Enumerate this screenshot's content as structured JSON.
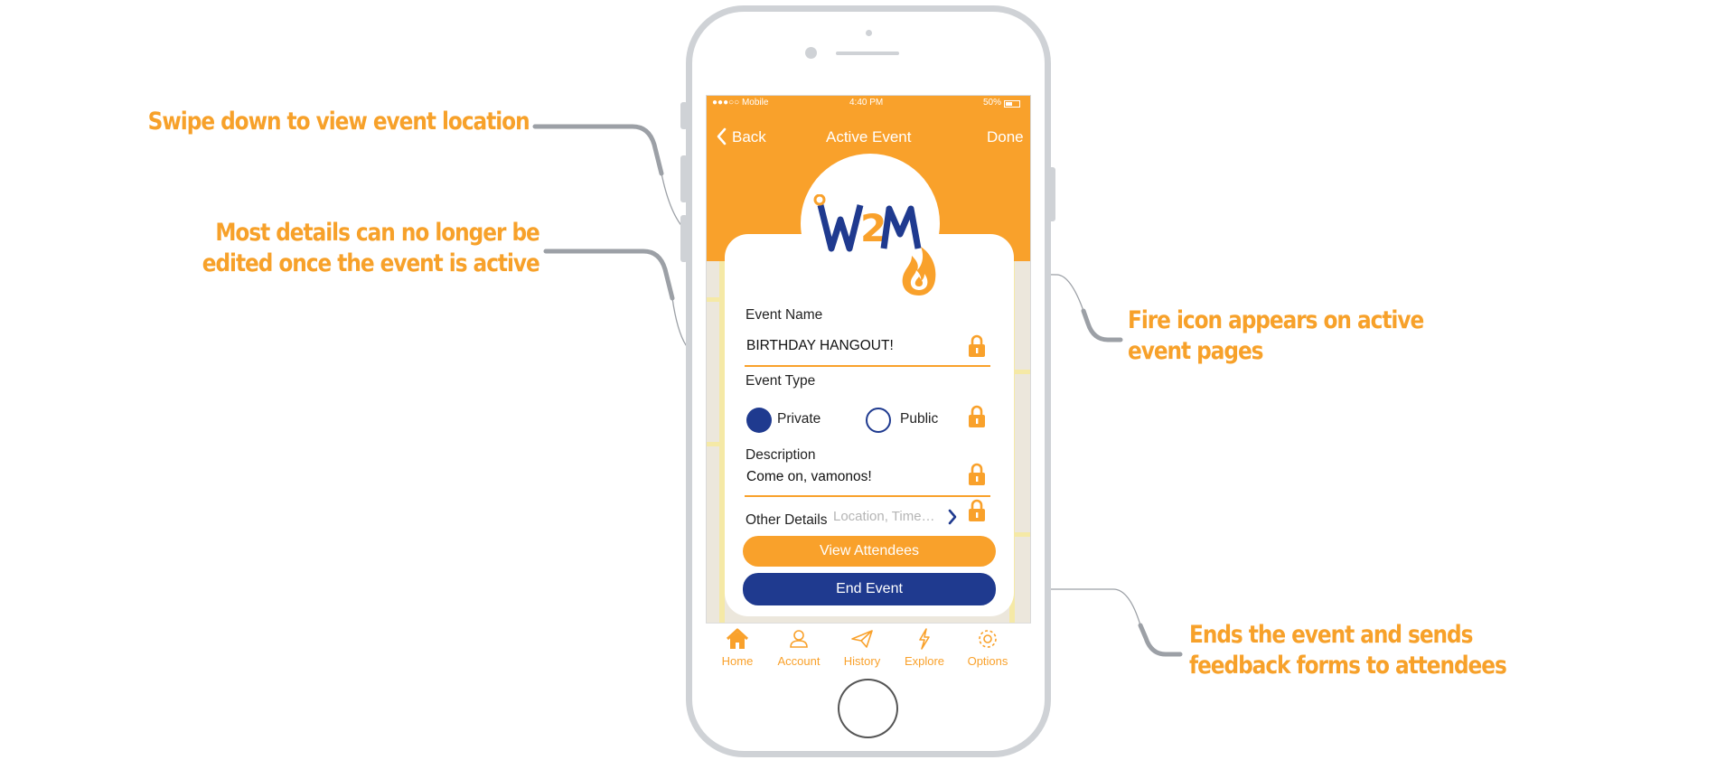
{
  "annotations": {
    "swipe": [
      "Swipe down to view event location"
    ],
    "details": [
      "Most details can no longer be",
      "edited once the event is active"
    ],
    "fire": [
      "Fire icon appears on active",
      "event pages"
    ],
    "end": [
      "Ends the event and sends",
      "feedback forms to attendees"
    ]
  },
  "status_bar": {
    "carrier": "●●●○○ Mobile",
    "time": "4:40 PM",
    "battery": "50%"
  },
  "nav": {
    "back": "Back",
    "title": "Active Event",
    "done": "Done"
  },
  "logo": {
    "text_pre": "W",
    "text_mid": "2",
    "text_post": "M"
  },
  "form": {
    "event_name_label": "Event Name",
    "event_name_value": "BIRTHDAY HANGOUT!",
    "event_type_label": "Event Type",
    "type_options": [
      "Private",
      "Public"
    ],
    "type_selected": "Private",
    "description_label": "Description",
    "description_value": "Come on, vamonos!",
    "other_details_label": "Other Details",
    "other_details_placeholder": "Location, Time…"
  },
  "buttons": {
    "view_attendees": "View Attendees",
    "end_event": "End Event"
  },
  "tabs": [
    {
      "label": "Home",
      "icon": "home-icon"
    },
    {
      "label": "Account",
      "icon": "account-icon"
    },
    {
      "label": "History",
      "icon": "history-icon"
    },
    {
      "label": "Explore",
      "icon": "explore-icon"
    },
    {
      "label": "Options",
      "icon": "options-icon"
    }
  ],
  "colors": {
    "accent": "#f9a12b",
    "brand_navy": "#1f3a8f",
    "annotation": "#f7a12a"
  }
}
